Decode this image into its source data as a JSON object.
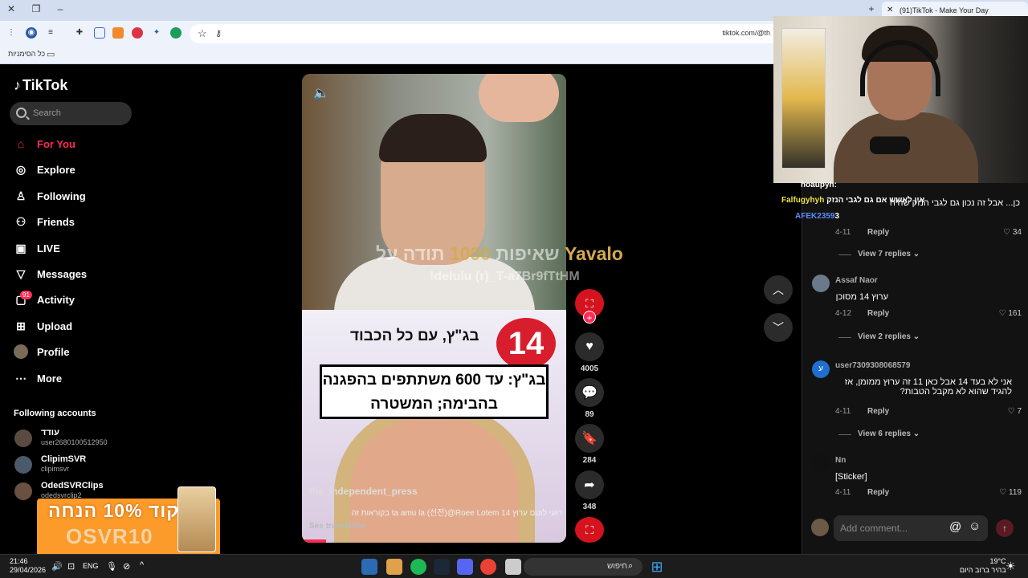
{
  "browser": {
    "tab_title": "(91)TikTok - Make Your Day",
    "url": "tiktok.com/@th",
    "bookmarks_label": "כל הסימניות"
  },
  "sidebar": {
    "logo": "TikTok",
    "search_placeholder": "Search",
    "items": [
      {
        "label": "For You",
        "icon": "home-icon",
        "active": true
      },
      {
        "label": "Explore",
        "icon": "compass-icon"
      },
      {
        "label": "Following",
        "icon": "following-icon"
      },
      {
        "label": "Friends",
        "icon": "friends-icon"
      },
      {
        "label": "LIVE",
        "icon": "live-icon"
      },
      {
        "label": "Messages",
        "icon": "messages-icon"
      },
      {
        "label": "Activity",
        "icon": "activity-icon",
        "badge": "91"
      },
      {
        "label": "Upload",
        "icon": "upload-icon"
      },
      {
        "label": "Profile",
        "icon": "profile-icon"
      },
      {
        "label": "More",
        "icon": "more-icon"
      }
    ],
    "following_heading": "Following accounts",
    "following": [
      {
        "name": "עודד",
        "handle": "user2680100512950"
      },
      {
        "name": "ClipimSVR",
        "handle": "clipimsvr"
      },
      {
        "name": "OdedSVRClips",
        "handle": "odedsvrclip2"
      }
    ]
  },
  "promo": {
    "line1": "קוד 10% הנחה",
    "line2": "OSVR10"
  },
  "video": {
    "headline": "בג\"ץ, עם כל הכבוד",
    "channel": "14",
    "box_text": "בג\"ץ: עד 600 משתתפים בהפגנה בהבימה; המשטרה",
    "author": "the_independent_press",
    "caption": "רועי לוטם ערוץ 14 ta amu la (선전)@Roee Lotem בקוראות זה",
    "see_translation": "See translation",
    "progress": 0.09
  },
  "overlay": {
    "thanks": "תודה על",
    "amount": "1000",
    "word": "שאיפות",
    "name": "Yavalo",
    "command": "!delulu (r)_T-a7Br9fTtHM"
  },
  "actions": {
    "likes": "4005",
    "comments": "89",
    "saves": "284",
    "shares": "348"
  },
  "chat": [
    {
      "user": "hoaupyh:",
      "color": "#ffffff"
    },
    {
      "user": "Falfugyhyh",
      "text": "אין לאשש אם גם לגבי הנזק",
      "color": "#e9e043"
    },
    {
      "user": "AFEK2359",
      "text": "3",
      "color": "#5a8dff"
    }
  ],
  "comments": [
    {
      "text": "כן... אבל זה נכון גם לגבי הנזק שהיה",
      "date": "4-11",
      "reply": "Reply",
      "likes": "34",
      "views": "View 7 replies"
    },
    {
      "name": "Assaf Naor",
      "text": "ערוץ 14 מסוכן",
      "date": "4-12",
      "reply": "Reply",
      "likes": "161",
      "views": "View 2 replies"
    },
    {
      "name": "user7309308068579",
      "text": "אני לא בעד 14 אבל כאן 11 זה ערוץ ממומן, אז להגיד שהוא לא מקבל הטבות?",
      "date": "4-11",
      "reply": "Reply",
      "likes": "7",
      "views": "View 6 replies"
    },
    {
      "name": "Nn",
      "text": "[Sticker]",
      "date": "4-11",
      "reply": "Reply",
      "likes": "119"
    }
  ],
  "add_comment_placeholder": "Add comment...",
  "taskbar": {
    "time": "21:46",
    "date": "29/04/2026",
    "lang": "ENG",
    "search_placeholder": "חיפוש",
    "temp": "19°C",
    "weather": "בהיר ברוב היום"
  }
}
